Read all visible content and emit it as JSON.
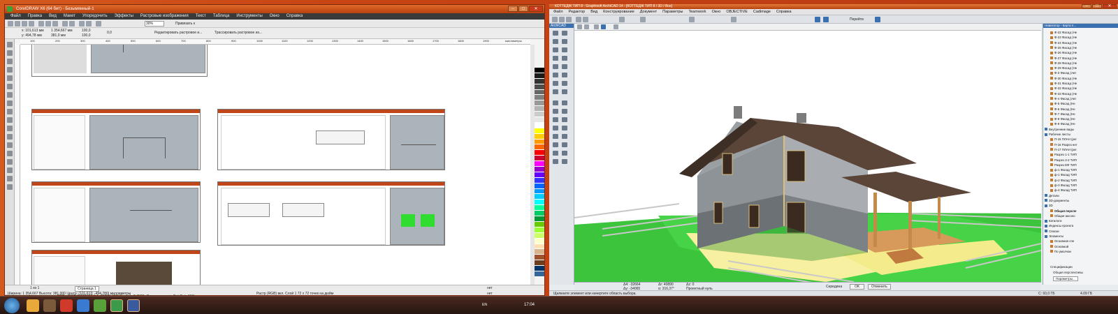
{
  "corel": {
    "title": "CorelDRAW X6 (64 бит) - Безымянный-1",
    "menu": [
      "Файл",
      "Правка",
      "Вид",
      "Макет",
      "Упорядочить",
      "Эффекты",
      "Растровые изображения",
      "Текст",
      "Таблица",
      "Инструменты",
      "Окно",
      "Справка"
    ],
    "zoom": "30%",
    "snap_label": "Привязать к",
    "prop": {
      "x": "x: 101,613 мм",
      "y": "y: 494,78 мм",
      "w": "1 354,667 мм",
      "h": "381,0 мм",
      "sx": "100,0",
      "sy": "100,0",
      "angle": "0,0",
      "edit_bitmap": "Редактировать растровое и...",
      "trace_bitmap": "Трассировать растровое из..."
    },
    "ruler_unit": "миллиметры",
    "ruler_ticks": [
      "100",
      "200",
      "300",
      "400",
      "500",
      "600",
      "700",
      "800",
      "900",
      "1000",
      "1100",
      "1200",
      "1300",
      "1400",
      "1500",
      "1600",
      "1700",
      "1800",
      "1900"
    ],
    "page_nav": "1 из 1",
    "page_tab": "Страница 1",
    "status_dims": "Ширина: 1 354,667 Высота: 381,000 Центр: (101,613; -494,780) миллиметры",
    "status_bitmap": "Растр (RGB) вкл. Слой 1 72 x 72 точек на дюйм",
    "status_color_profile": "Цветовые профили документа: RGB: sRGB IEC61966-2.1; CMYK: ISO Coated v2 (ECI); Оттенки серого: Dot Gain 15%",
    "fill_none": "нет",
    "outline_none": "нет",
    "palette_colors": [
      "#000000",
      "#1a1a1a",
      "#333333",
      "#4d4d4d",
      "#666666",
      "#808080",
      "#999999",
      "#b3b3b3",
      "#cccccc",
      "#e6e6e6",
      "#ffffff",
      "#ffff00",
      "#ffcc00",
      "#ff9900",
      "#ff6600",
      "#ff0000",
      "#cc0033",
      "#ff00ff",
      "#9900cc",
      "#6600ff",
      "#3333ff",
      "#0066ff",
      "#0099ff",
      "#00ccff",
      "#00ffff",
      "#00ff99",
      "#00cc66",
      "#009933",
      "#66cc00",
      "#99ff33",
      "#ccff66",
      "#ffffcc",
      "#ffe0b0",
      "#d9b38c",
      "#a0522d",
      "#6b3e1f",
      "#003366",
      "#336699"
    ]
  },
  "archicad": {
    "title": "КОТТЕДЖ ТИП 8 - Graphisoft ArchiCAD 14 - [КОТТЕДЖ ТИП 8 / 3D / Все]",
    "menu": [
      "Файл",
      "Редактор",
      "Вид",
      "Конструирование",
      "Документ",
      "Параметры",
      "Teamwork",
      "Окно",
      "OBJECTIVE",
      "Cadimage",
      "Справка"
    ],
    "toolbox_title": "ArchiCAD",
    "goto_label": "Перейти",
    "navigator_title": "Навигатор - Карта п...",
    "navigator_items": [
      {
        "label": "Ф-22 Фасад (Не",
        "kind": "view"
      },
      {
        "label": "Ф-23 Фасад (Не",
        "kind": "view"
      },
      {
        "label": "Ф-24 Фасад (Не",
        "kind": "view"
      },
      {
        "label": "Ф-25 Фасад (Не",
        "kind": "view"
      },
      {
        "label": "Ф-26 Фасад (Не",
        "kind": "view"
      },
      {
        "label": "Ф-27 Фасад (Не",
        "kind": "view"
      },
      {
        "label": "Ф-28 Фасад (Не",
        "kind": "view"
      },
      {
        "label": "Ф-29 Фасад (Не",
        "kind": "view"
      },
      {
        "label": "Ф-3 Фасад (Авт",
        "kind": "view"
      },
      {
        "label": "Ф-30 Фасад (Не",
        "kind": "view"
      },
      {
        "label": "Ф-31 Фасад (Не",
        "kind": "view"
      },
      {
        "label": "Ф-32 Фасад (Не",
        "kind": "view"
      },
      {
        "label": "Ф-33 Фасад (Не",
        "kind": "view"
      },
      {
        "label": "Ф-4 Фасад (Авт",
        "kind": "view"
      },
      {
        "label": "Ф-5 Фасад (Не",
        "kind": "view"
      },
      {
        "label": "Ф-6 Фасад (Не",
        "kind": "view"
      },
      {
        "label": "Ф-7 Фасад (Не",
        "kind": "view"
      },
      {
        "label": "Ф-8 Фасад (Не",
        "kind": "view"
      },
      {
        "label": "Ф-9 Фасад (Не",
        "kind": "view"
      },
      {
        "label": "Внутренние виды",
        "kind": "folder"
      },
      {
        "label": "Рабочие листы",
        "kind": "folder"
      },
      {
        "label": "П-15 ПЛАН (рег",
        "kind": "sheet"
      },
      {
        "label": "П-16 Разрез нет",
        "kind": "sheet"
      },
      {
        "label": "П-17 ПЛАН (рег",
        "kind": "sheet"
      },
      {
        "label": "Разрез 1-1 ТИП",
        "kind": "sheet"
      },
      {
        "label": "Разрез 2-2 ТИП",
        "kind": "sheet"
      },
      {
        "label": "Разрез ЕФ ТИП",
        "kind": "sheet"
      },
      {
        "label": "ф-1 Фасад ТИП",
        "kind": "sheet"
      },
      {
        "label": "ф-1 Фасад ТИП",
        "kind": "sheet"
      },
      {
        "label": "ф-2 Фасад ТИП",
        "kind": "sheet"
      },
      {
        "label": "ф-3 Фасад ТИП",
        "kind": "sheet"
      },
      {
        "label": "ф-4 Фасад ТИП",
        "kind": "sheet"
      },
      {
        "label": "Детали",
        "kind": "folder"
      },
      {
        "label": "3D-документы",
        "kind": "folder"
      },
      {
        "label": "3D",
        "kind": "folder"
      },
      {
        "label": "Общая перспе",
        "kind": "bold"
      },
      {
        "label": "Общая аксоно",
        "kind": "view"
      },
      {
        "label": "Каталоги",
        "kind": "folder"
      },
      {
        "label": "Индексы проекта",
        "kind": "folder"
      },
      {
        "label": "Списки",
        "kind": "folder"
      },
      {
        "label": "Элементы",
        "kind": "folder"
      },
      {
        "label": "Основная спе",
        "kind": "view"
      },
      {
        "label": "Основной",
        "kind": "view"
      },
      {
        "label": "По умолчан",
        "kind": "view"
      }
    ],
    "specs_label": "Спецификации",
    "perspective_params": "Общая перспективы",
    "params_button": "Параметры...",
    "coord_dx": "Δ4: -32664",
    "coord_dy": "Δу: -34065",
    "coord_r": "Δr: 40890",
    "coord_a": "α: 316,37°",
    "coord_z": "Δz: 0",
    "coord_proj": "Проектный нуль",
    "coord_mid": "Середина",
    "ok_button": "OK",
    "cancel_button": "Отменить",
    "status_text": "Щелкните элемент или начертите область выбора.",
    "disk_free": "C: 93,0 ГБ",
    "mem": "4.09 ГБ"
  },
  "taskbar": {
    "lang": "EN",
    "time": "17:04"
  }
}
